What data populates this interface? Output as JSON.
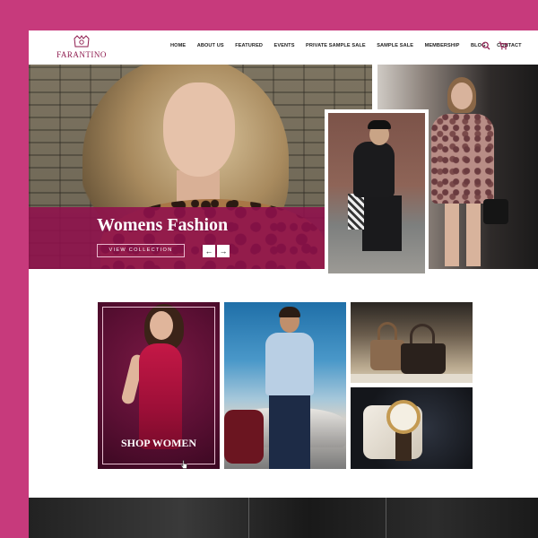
{
  "brand": {
    "name": "FARANTINO"
  },
  "nav": {
    "items": [
      "HOME",
      "ABOUT US",
      "FEATURED",
      "EVENTS",
      "PRIVATE SAMPLE SALE",
      "SAMPLE SALE",
      "MEMBERSHIP",
      "BLOG",
      "CONTACT"
    ]
  },
  "header_icons": {
    "search": "search-icon",
    "cart": "cart-icon"
  },
  "hero": {
    "title": "Womens Fashion",
    "cta": "VIEW COLLECTION",
    "prev": "←",
    "next": "→"
  },
  "tiles": {
    "women_label": "SHOP WOMEN"
  },
  "colors": {
    "background": "#c73a7c",
    "accent": "#8f104c",
    "brand_text": "#8e1b4e"
  }
}
